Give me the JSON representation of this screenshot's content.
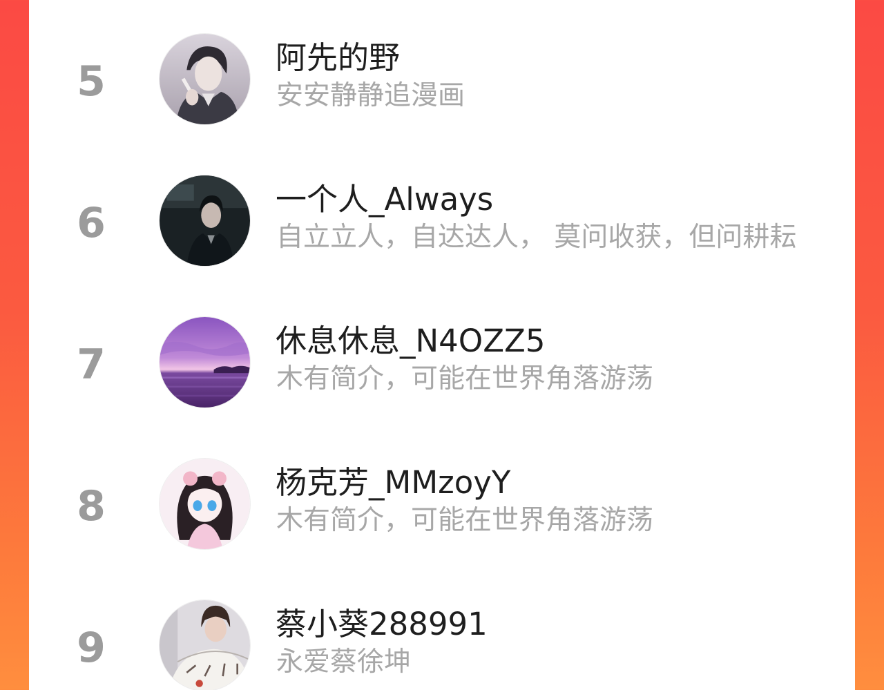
{
  "ranking": {
    "items": [
      {
        "rank": "5",
        "name": "阿先的野",
        "bio": "安安静静追漫画",
        "avatar_icon": "anime-man-avatar-icon",
        "avatar_colors": [
          "#3b3a44",
          "#c9c3cc"
        ]
      },
      {
        "rank": "6",
        "name": "一个人_Always",
        "bio": "自立立人，自达达人， 莫问收获，但问耕耘",
        "avatar_icon": "man-in-car-avatar-icon",
        "avatar_colors": [
          "#141a1c",
          "#4d5a5d"
        ]
      },
      {
        "rank": "7",
        "name": "休息休息_N4OZZ5",
        "bio": "木有简介，可能在世界角落游荡",
        "avatar_icon": "purple-sunset-sea-avatar-icon",
        "avatar_colors": [
          "#9a63c7",
          "#5a2f7a"
        ]
      },
      {
        "rank": "8",
        "name": "杨克芳_MMzoyY",
        "bio": "木有简介，可能在世界角落游荡",
        "avatar_icon": "anime-girl-avatar-icon",
        "avatar_colors": [
          "#f6e6ee",
          "#2a2025"
        ]
      },
      {
        "rank": "9",
        "name": "蔡小葵288991",
        "bio": "永爱蔡徐坤",
        "avatar_icon": "boy-with-fan-avatar-icon",
        "avatar_colors": [
          "#d9d6dc",
          "#8a7c78"
        ]
      }
    ]
  }
}
